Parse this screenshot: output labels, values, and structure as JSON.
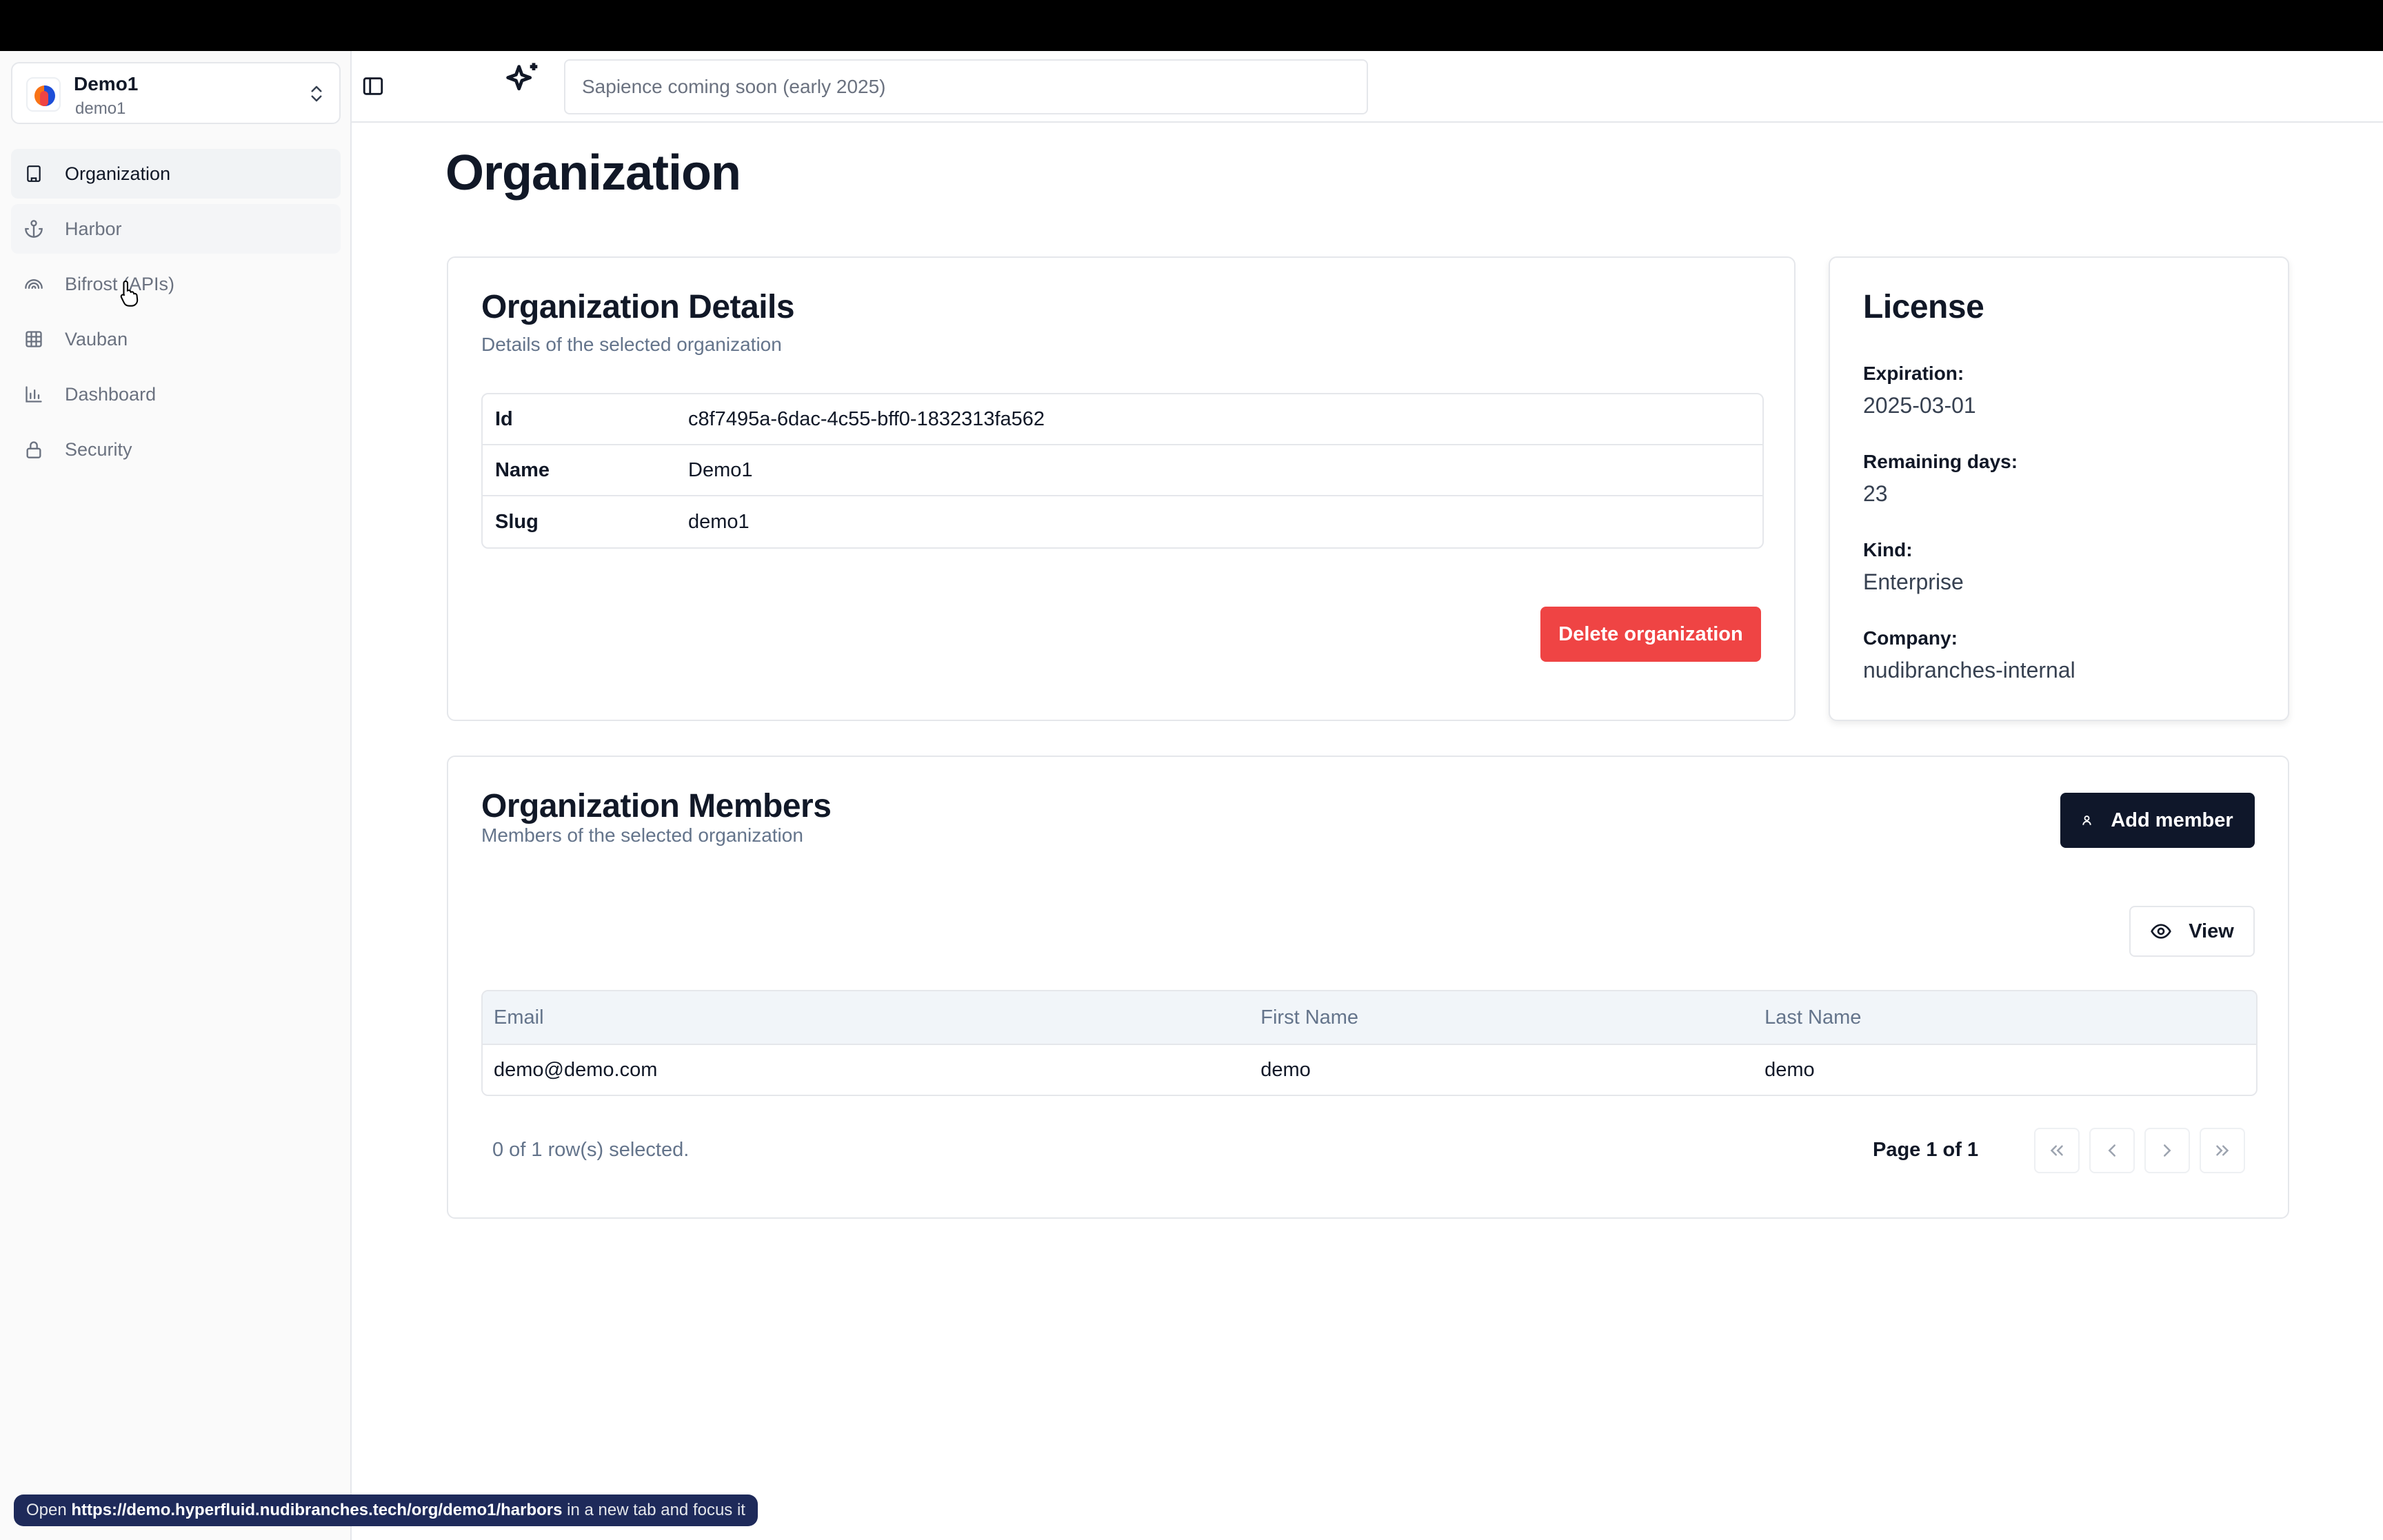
{
  "org_switcher": {
    "name": "Demo1",
    "slug": "demo1"
  },
  "sidebar": {
    "items": [
      {
        "label": "Organization",
        "icon": "building-icon",
        "active": true
      },
      {
        "label": "Harbor",
        "icon": "anchor-icon",
        "hover": true
      },
      {
        "label": "Bifrost (APIs)",
        "icon": "rainbow-icon"
      },
      {
        "label": "Vauban",
        "icon": "grid-icon"
      },
      {
        "label": "Dashboard",
        "icon": "bar-chart-icon"
      },
      {
        "label": "Security",
        "icon": "lock-icon"
      }
    ]
  },
  "header": {
    "search_placeholder": "Sapience coming soon (early 2025)"
  },
  "page": {
    "title": "Organization"
  },
  "details": {
    "title": "Organization Details",
    "description": "Details of the selected organization",
    "rows": [
      {
        "key": "Id",
        "value": "c8f7495a-6dac-4c55-bff0-1832313fa562"
      },
      {
        "key": "Name",
        "value": "Demo1"
      },
      {
        "key": "Slug",
        "value": "demo1"
      }
    ],
    "delete_label": "Delete organization"
  },
  "license": {
    "title": "License",
    "fields": [
      {
        "label": "Expiration:",
        "value": "2025-03-01"
      },
      {
        "label": "Remaining days:",
        "value": "23"
      },
      {
        "label": "Kind:",
        "value": "Enterprise"
      },
      {
        "label": "Company:",
        "value": "nudibranches-internal"
      }
    ]
  },
  "members": {
    "title": "Organization Members",
    "description": "Members of the selected organization",
    "add_label": "Add member",
    "view_label": "View",
    "columns": [
      "Email",
      "First Name",
      "Last Name"
    ],
    "rows": [
      {
        "email": "demo@demo.com",
        "first_name": "demo",
        "last_name": "demo"
      }
    ],
    "selection_text": "0 of 1 row(s) selected.",
    "page_text": "Page 1 of 1"
  },
  "status_bar": {
    "prefix": "Open",
    "url": "https://demo.hyperfluid.nudibranches.tech/org/demo1/harbors",
    "suffix": "in a new tab and focus it"
  },
  "colors": {
    "accent_dark": "#0f172a",
    "danger": "#ef4444",
    "muted_text": "#64748b",
    "border": "#e5e7eb"
  }
}
